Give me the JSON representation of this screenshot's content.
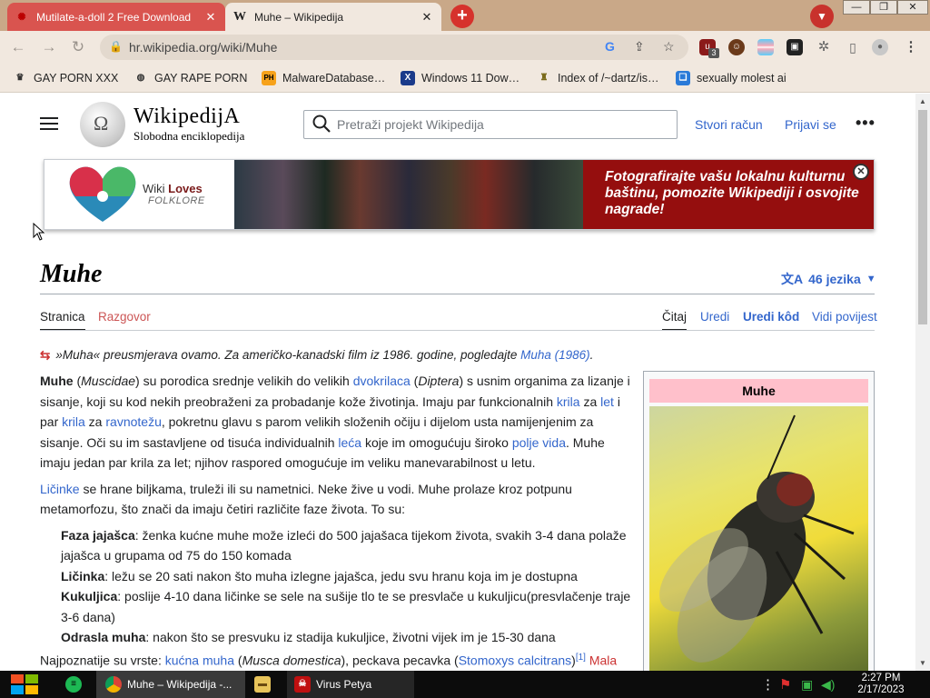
{
  "browser": {
    "tabs": [
      {
        "title": "Mutilate-a-doll 2 Free Download"
      },
      {
        "title": "Muhe – Wikipedija"
      }
    ],
    "address": {
      "url": "hr.wikipedia.org/wiki/Muhe"
    },
    "extension_badge": "3",
    "bookmarks": [
      {
        "label": "GAY PORN XXX"
      },
      {
        "label": "GAY RAPE PORN"
      },
      {
        "label": "MalwareDatabase…"
      },
      {
        "label": "Windows 11 Dow…"
      },
      {
        "label": "Index of /~dartz/is…"
      },
      {
        "label": "sexually molest ai"
      }
    ]
  },
  "wiki": {
    "logo": {
      "wordmark": "WikipedijA",
      "tagline": "Slobodna enciklopedija"
    },
    "search": {
      "placeholder": "Pretraži projekt Wikipedija"
    },
    "create_account": "Stvori račun",
    "login": "Prijavi se",
    "banner": {
      "brand_1": "Wiki",
      "brand_2": "Loves",
      "brand_3": "FOLKLORE",
      "message": "Fotografirajte vašu lokalnu kulturnu baštinu, pomozite Wikipediji i osvojite nagrade!"
    },
    "title": "Muhe",
    "languages": "46 jezika",
    "tabs": {
      "page": "Stranica",
      "talk": "Razgovor",
      "read": "Čitaj",
      "edit": "Uredi",
      "edit_source": "Uredi kôd",
      "history": "Vidi povijest"
    },
    "hatnote": {
      "text": "»Muha« preusmjerava ovamo. Za američko-kanadski film iz 1986. godine, pogledajte ",
      "link": "Muha (1986)",
      "end": "."
    },
    "infobox": {
      "title": "Muhe"
    },
    "article": {
      "p1": {
        "t1": "Muhe",
        "t2": " (",
        "t3": "Muscidae",
        "t4": ") su porodica srednje velikih do velikih ",
        "l1": "dvokrilaca",
        "t5": " (",
        "t6": "Diptera",
        "t7": ") s usnim organima za lizanje i sisanje, koji su kod nekih preobraženi za probadanje kože životinja. Imaju par funkcionalnih ",
        "l2": "krila",
        "t8": " za ",
        "l3": "let",
        "t9": " i par ",
        "l4": "krila",
        "t10": " za ",
        "l5": "ravnotežu",
        "t11": ", pokretnu glavu s parom velikih složenih očiju i dijelom usta namijenjenim za sisanje. Oči su im sastavljene od tisuća individualnih ",
        "l6": "leća",
        "t12": " koje im omogućuju široko ",
        "l7": "polje vida",
        "t13": ". Muhe imaju jedan par krila za let; njihov raspored omogućuje im veliku manevarabilnost u letu."
      },
      "p2": {
        "l1": "Ličinke",
        "t1": " se hrane biljkama, truleži ili su nametnici. Neke žive u vodi. Muhe prolaze kroz potpunu metamorfozu, što znači da imaju četiri različite faze života. To su:"
      },
      "stages": [
        {
          "name": "Faza jajašca",
          "text": ": ženka kućne muhe može izleći do 500 jajašaca tijekom života, svakih 3-4 dana polaže jajašca u grupama od 75 do 150 komada"
        },
        {
          "name": "Ličinka",
          "text": ": ležu se 20 sati nakon što muha izlegne jajašca, jedu svu hranu koja im je dostupna"
        },
        {
          "name": "Kukuljica",
          "text": ": poslije 4-10 dana ličinke se sele na sušije tlo te se presvlače u kukuljicu(presvlačenje traje 3-6 dana)"
        },
        {
          "name": "Odrasla muha",
          "text": ": nakon što se presvuku iz stadija kukuljice, životni vijek im je 15-30 dana"
        }
      ],
      "p3": {
        "t1": "Najpoznatije su vrste: ",
        "l1": "kućna muha",
        "t2": " (",
        "t3": "Musca domestica",
        "t4": "), peckava pecavka (",
        "l2": "Stomoxys calcitrans",
        "t5": ")",
        "sup": "[1]",
        "l3": " Mala"
      }
    }
  },
  "taskbar": {
    "items": [
      {
        "label": "Muhe – Wikipedija -..."
      },
      {
        "label": "Virus Petya"
      }
    ],
    "clock": {
      "time": "2:27 PM",
      "date": "2/17/2023"
    }
  },
  "colors": {
    "link": "#3366cc",
    "banner_red": "#950e0e",
    "infobox_header": "#ffc0cb",
    "tab_active": "#d9544f"
  }
}
